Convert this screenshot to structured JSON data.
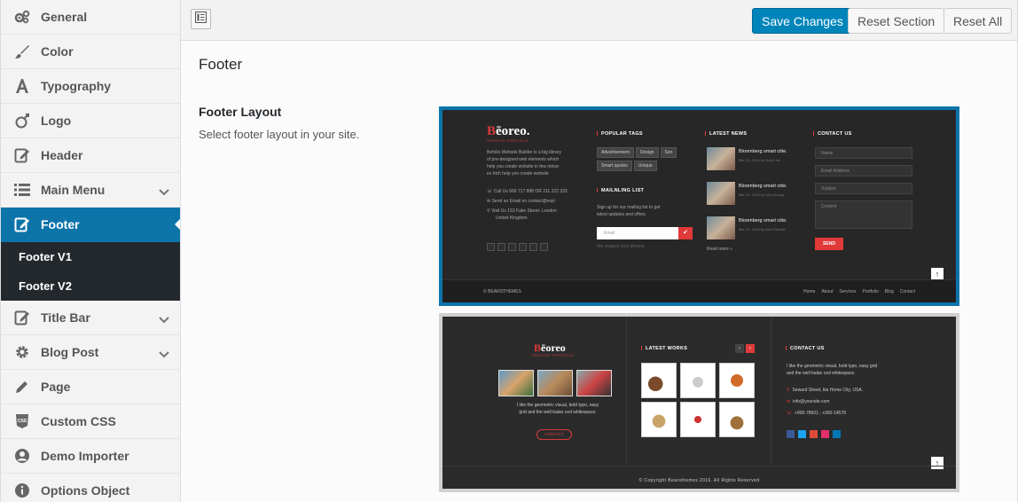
{
  "sidebar": {
    "items": [
      {
        "label": "General",
        "icon": "gears-icon"
      },
      {
        "label": "Color",
        "icon": "brush-icon"
      },
      {
        "label": "Typography",
        "icon": "font-icon"
      },
      {
        "label": "Logo",
        "icon": "logo-icon"
      },
      {
        "label": "Header",
        "icon": "edit-icon"
      },
      {
        "label": "Main Menu",
        "icon": "list-icon"
      },
      {
        "label": "Footer",
        "icon": "edit-icon"
      },
      {
        "label": "Title Bar",
        "icon": "edit-icon"
      },
      {
        "label": "Blog Post",
        "icon": "gear-icon"
      },
      {
        "label": "Page",
        "icon": "pencil-icon"
      },
      {
        "label": "Custom CSS",
        "icon": "css-icon"
      },
      {
        "label": "Demo Importer",
        "icon": "user-icon"
      },
      {
        "label": "Options Object",
        "icon": "info-icon"
      }
    ],
    "footer_subitems": [
      "Footer V1",
      "Footer V2"
    ]
  },
  "toolbar": {
    "save_label": "Save Changes",
    "reset_section_label": "Reset Section",
    "reset_all_label": "Reset All"
  },
  "page": {
    "title": "Footer",
    "field_label": "Footer Layout",
    "field_desc": "Select footer layout in your site."
  },
  "preview1": {
    "logo_main": "ēoreo.",
    "logo_b": "B",
    "logo_sub": "CREATIVE PORTFOLIO",
    "about": [
      "Befolio Website Builder is a big library",
      "of pre-designed web elements which",
      "help you create website in few minut-",
      "es hich help you create website"
    ],
    "contact": [
      "Call Us 666 717 888 OR 211 222 333",
      "Send an Email on contact@expl",
      "Visit Us 153 Fake Street- London",
      "United Kingdom"
    ],
    "popular_tags_title": "POPULAR TAGS",
    "tags": [
      "Advertisement",
      "Design",
      "Seo",
      "Smart quotes",
      "Unique"
    ],
    "mailing_title": "MAILNLING LIST",
    "mailing_desc": [
      "Sign up for our mailing list to get",
      "latest updates and offers."
    ],
    "email_placeholder": "Email",
    "privacy": "We respect your privacy.",
    "news_title": "LATEST NEWS",
    "news": [
      {
        "title": "Bloomberg smart citie.",
        "date": "Mar 22, 2016 by Good Joe"
      },
      {
        "title": "Bloomberg smart citie.",
        "date": "Mar 22, 2016 by John Kenny"
      },
      {
        "title": "Bloomberg smart citie.",
        "date": "Mar 22, 2016 by Alan Stewart"
      }
    ],
    "read_more": "Read more »",
    "contact_title": "CONTACT US",
    "form_fields": [
      "Name",
      "Email Address",
      "Subject",
      "Content"
    ],
    "send": "SEND",
    "copyright": "© BEARSTHEMES",
    "links": [
      "Home",
      "About",
      "Services",
      "Portfolio",
      "Blog",
      "Contact"
    ]
  },
  "preview2": {
    "logo_main": "ēoreo",
    "logo_b": "B",
    "logo_sub": "CREATIVE PORTFOLIO",
    "desc": [
      "I like the geometric visual, bold typo, easy",
      "grid and the well balan ced whitespace."
    ],
    "contact_btn": "CONTACT",
    "works_title": "LATEST WORKS",
    "contact_title": "CONTACT US",
    "contact_desc": [
      "I like the geometric visual, bold typo, easy grid",
      "and the well balan ced whitespace."
    ],
    "address": "Seward Street, kla Home City, USA.",
    "email": "info@yoursite.com",
    "phone": "+900-78601 ; +900-14578",
    "copyright": "© Copyright Bearsthemes 2016. All Rights Reserved"
  },
  "colors": {
    "accent": "#0d74aa",
    "primary_button": "#0085ba",
    "brand_red": "#e03a3a"
  }
}
